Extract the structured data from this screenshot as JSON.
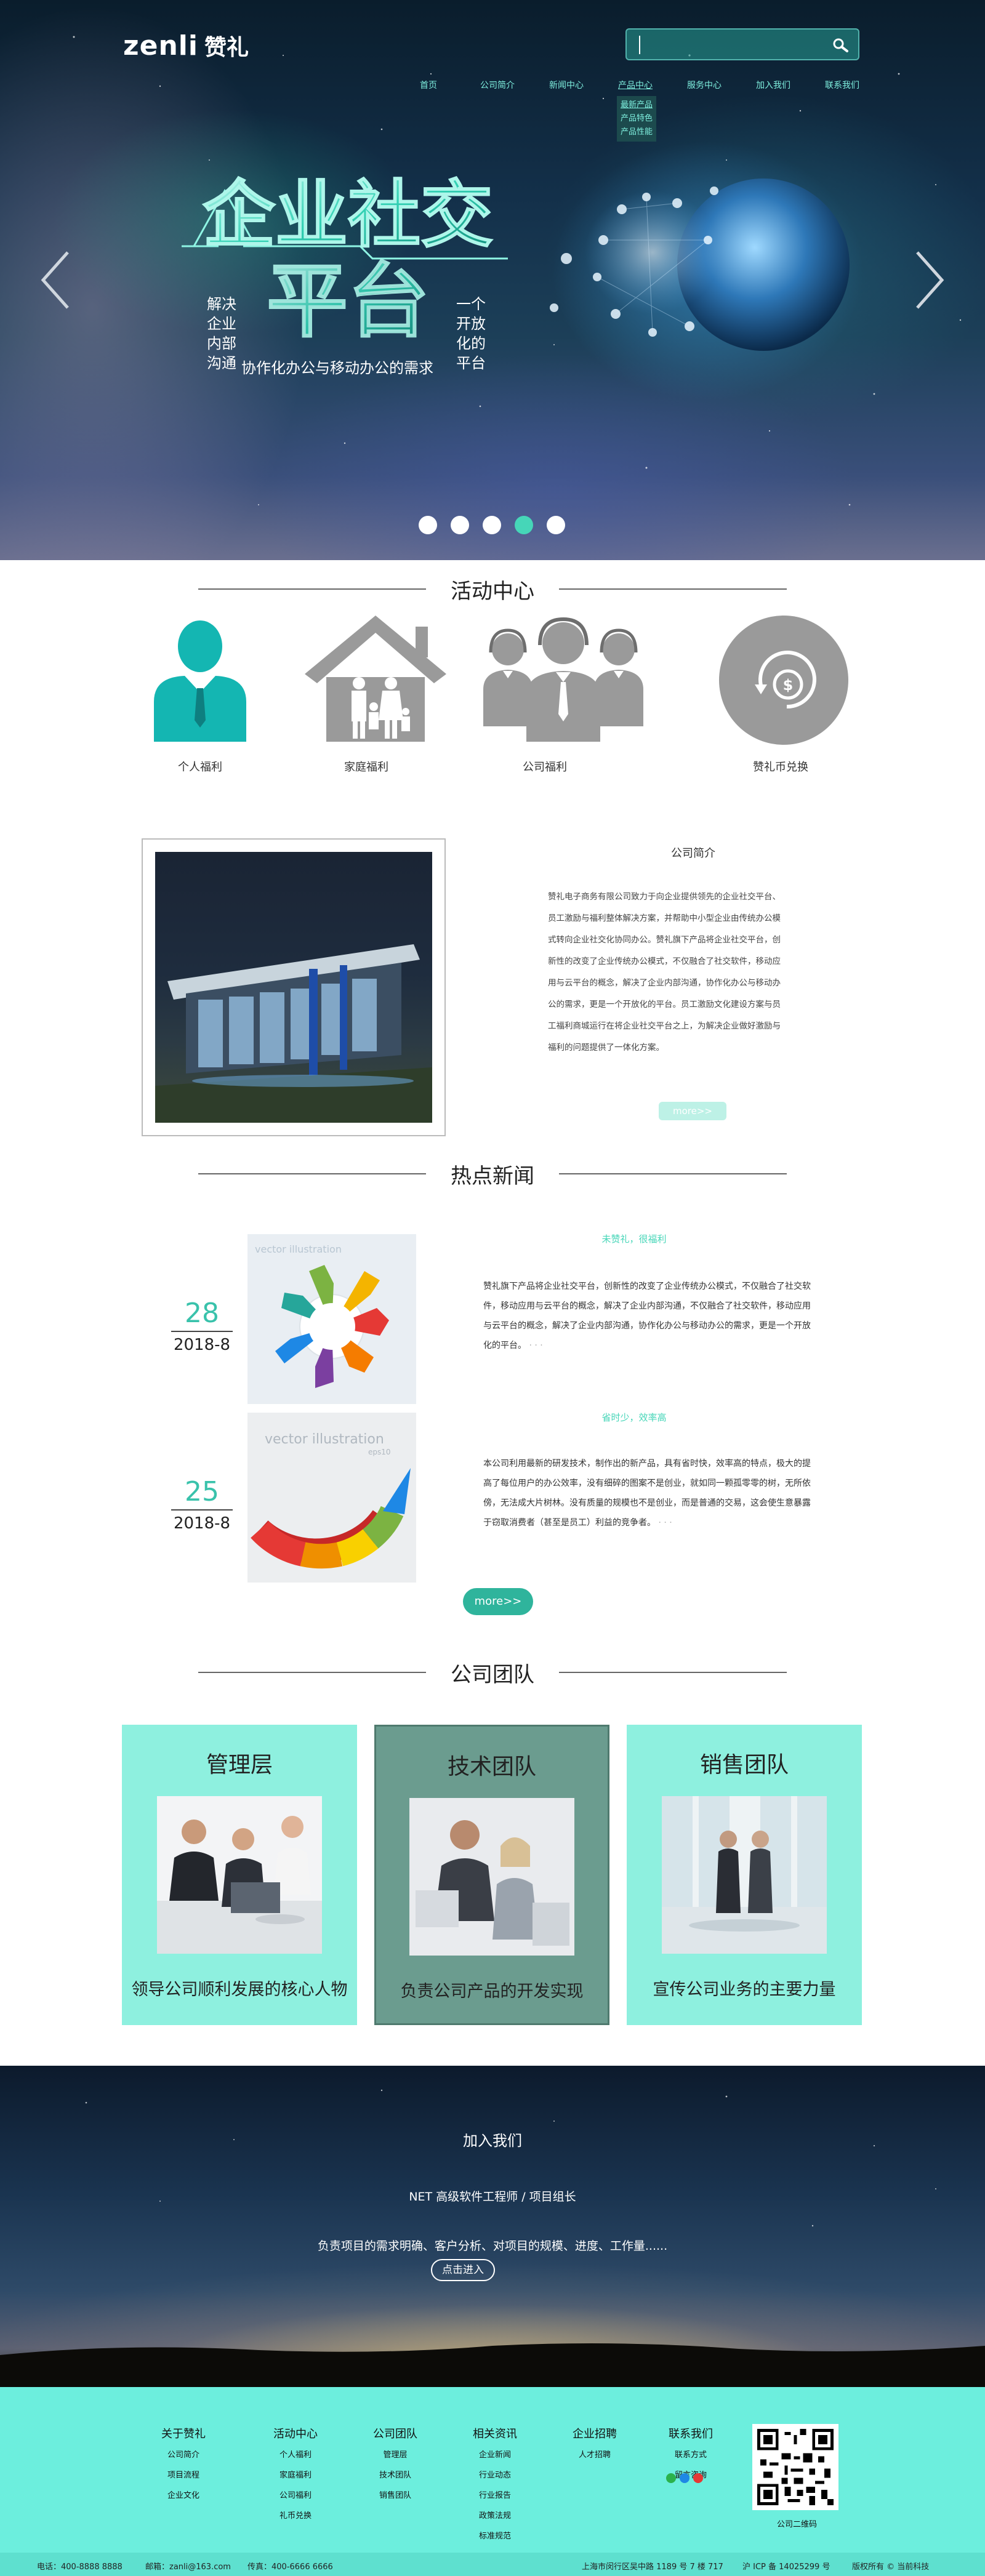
{
  "brand": {
    "logo_text": "zenli",
    "logo_cn": "赞礼"
  },
  "search": {
    "placeholder": ""
  },
  "nav": {
    "items": [
      "首页",
      "公司简介",
      "新闻中心",
      "产品中心",
      "服务中心",
      "加入我们",
      "联系我们"
    ],
    "submenu": [
      "最新产品",
      "产品特色",
      "产品性能"
    ]
  },
  "hero": {
    "title": "企业社交平台",
    "left_lines": [
      "解决",
      "企业",
      "内部",
      "沟通"
    ],
    "middle": "协作化办公与移动办公的需求",
    "right_lines": [
      "一个",
      "开放",
      "化的",
      "平台"
    ],
    "slide_count": 5,
    "active_slide": 4
  },
  "activity": {
    "title": "活动中心",
    "items": [
      "个人福利",
      "家庭福利",
      "公司福利",
      "赞礼币兑换"
    ]
  },
  "about": {
    "title": "公司简介",
    "text": "赞礼电子商务有限公司致力于向企业提供领先的企业社交平台、员工激励与福利整体解决方案，并帮助中小型企业由传统办公模式转向企业社交化协同办公。赞礼旗下产品将企业社交平台，创新性的改变了企业传统办公模式，不仅融合了社交软件，移动应用与云平台的概念，解决了企业内部沟通，协作化办公与移动办公的需求，更是一个开放化的平台。员工激励文化建设方案与员工福利商城运行在将企业社交平台之上，为解决企业做好激励与福利的问题提供了一体化方案。",
    "more": "more>>"
  },
  "news": {
    "title": "热点新闻",
    "items": [
      {
        "day": "28",
        "ym": "2018-8",
        "headline": "未赞礼，很福利",
        "body": "赞礼旗下产品将企业社交平台，创新性的改变了企业传统办公模式，不仅融合了社交软件，移动应用与云平台的概念，解决了企业内部沟通，不仅融合了社交软件，移动应用与云平台的概念，解决了企业内部沟通，协作化办公与移动办公的需求，更是一个开放化的平台。",
        "ellipsis": "· · ·"
      },
      {
        "day": "25",
        "ym": "2018-8",
        "headline": "省时少，效率高",
        "body": "本公司利用最新的研发技术，制作出的新产品，具有省时快，效率高的特点，极大的提高了每位用户的办公效率，没有细碎的图案不是创业，就如同一颗孤零零的树，无所依傍，无法成大片树林。没有质量的规模也不是创业，而是普通的交易，这会使生意暴露于窃取消费者（甚至是员工）利益的竞争者。",
        "ellipsis": "· · ·"
      }
    ],
    "more": "more>>"
  },
  "team": {
    "title": "公司团队",
    "items": [
      {
        "name": "管理层",
        "desc": "领导公司顺利发展的核心人物"
      },
      {
        "name": "技术团队",
        "desc": "负责公司产品的开发实现"
      },
      {
        "name": "销售团队",
        "desc": "宣传公司业务的主要力量"
      }
    ]
  },
  "join": {
    "title": "加入我们",
    "position": "NET 高级软件工程师 / 项目组长",
    "desc": "负责项目的需求明确、客户分析、对项目的规模、进度、工作量......",
    "button": "点击进入"
  },
  "footer": {
    "columns": [
      {
        "title": "关于赞礼",
        "items": [
          "公司简介",
          "项目流程",
          "企业文化"
        ]
      },
      {
        "title": "活动中心",
        "items": [
          "个人福利",
          "家庭福利",
          "公司福利",
          "礼币兑换"
        ]
      },
      {
        "title": "公司团队",
        "items": [
          "管理层",
          "技术团队",
          "销售团队"
        ]
      },
      {
        "title": "相关资讯",
        "items": [
          "企业新闻",
          "行业动态",
          "行业报告",
          "政策法规",
          "标准规范"
        ]
      },
      {
        "title": "企业招聘",
        "items": [
          "人才招聘"
        ]
      },
      {
        "title": "联系我们",
        "items": [
          "联系方式",
          "留言咨询"
        ]
      }
    ],
    "qr_caption": "公司二维码",
    "bottom": {
      "phone": "电话：400-8888 8888",
      "email": "邮箱：zanli@163.com",
      "fax": "传真：400-6666 6666",
      "address": "上海市闵行区吴中路 1189 号 7 楼 717",
      "icp": "沪 ICP 备 14025299 号",
      "copyright": "版权所有 © 当前科技"
    }
  },
  "colors": {
    "accent": "#46d6b8",
    "teal_dark": "#2fb49c",
    "footer_bg": "#6ceedd",
    "mint": "#8ef0df",
    "team_mid": "#6b9c8f"
  }
}
